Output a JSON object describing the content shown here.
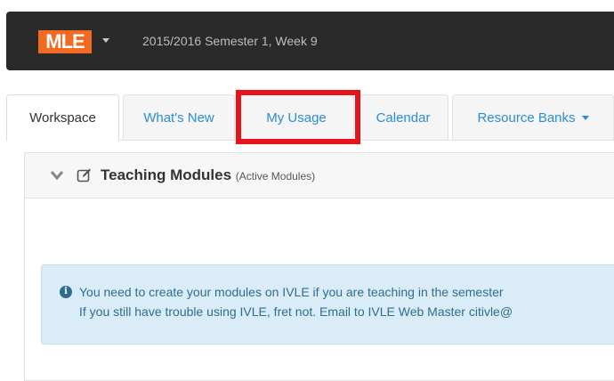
{
  "header": {
    "logo_text": "MLE",
    "semester": "2015/2016 Semester 1, Week 9"
  },
  "tabs": [
    {
      "label": "Workspace",
      "active": true
    },
    {
      "label": "What's New",
      "active": false
    },
    {
      "label": "My Usage",
      "active": false,
      "highlighted": true
    },
    {
      "label": "Calendar",
      "active": false
    },
    {
      "label": "Resource Banks",
      "active": false,
      "dropdown": true
    }
  ],
  "panel": {
    "title": "Teaching Modules",
    "subtitle": "(Active Modules)",
    "icons": [
      "chevron-down-icon",
      "edit-icon"
    ]
  },
  "alert": {
    "line1": "You need to create your modules on IVLE if you are teaching in the semester",
    "line2": "If you still have trouble using IVLE, fret not. Email to IVLE Web Master citivle@",
    "icon": "info-icon"
  },
  "colors": {
    "topbar": "#2a2a2a",
    "logo": "#f26b21",
    "link": "#2a8dd8",
    "highlight": "#e5131a",
    "alert_bg": "#d9ecf7",
    "alert_text": "#2d6e90"
  }
}
